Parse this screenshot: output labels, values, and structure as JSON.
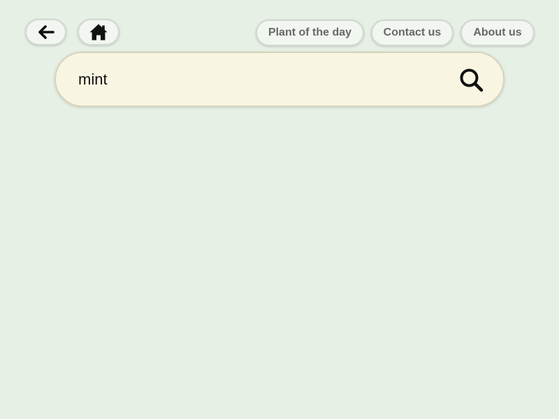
{
  "header": {
    "back_icon": "left-arrow-icon",
    "home_icon": "home-icon",
    "nav_items": [
      {
        "label": "Plant of the day"
      },
      {
        "label": "Contact us"
      },
      {
        "label": "About us"
      }
    ]
  },
  "search": {
    "value": "mint",
    "placeholder": "",
    "icon": "search-icon"
  },
  "colors": {
    "background": "#e6f0e5",
    "button_bg": "#f1f6f0",
    "nav_text": "#666a66",
    "search_bg": "#f8f6e2",
    "icon": "#111111"
  }
}
